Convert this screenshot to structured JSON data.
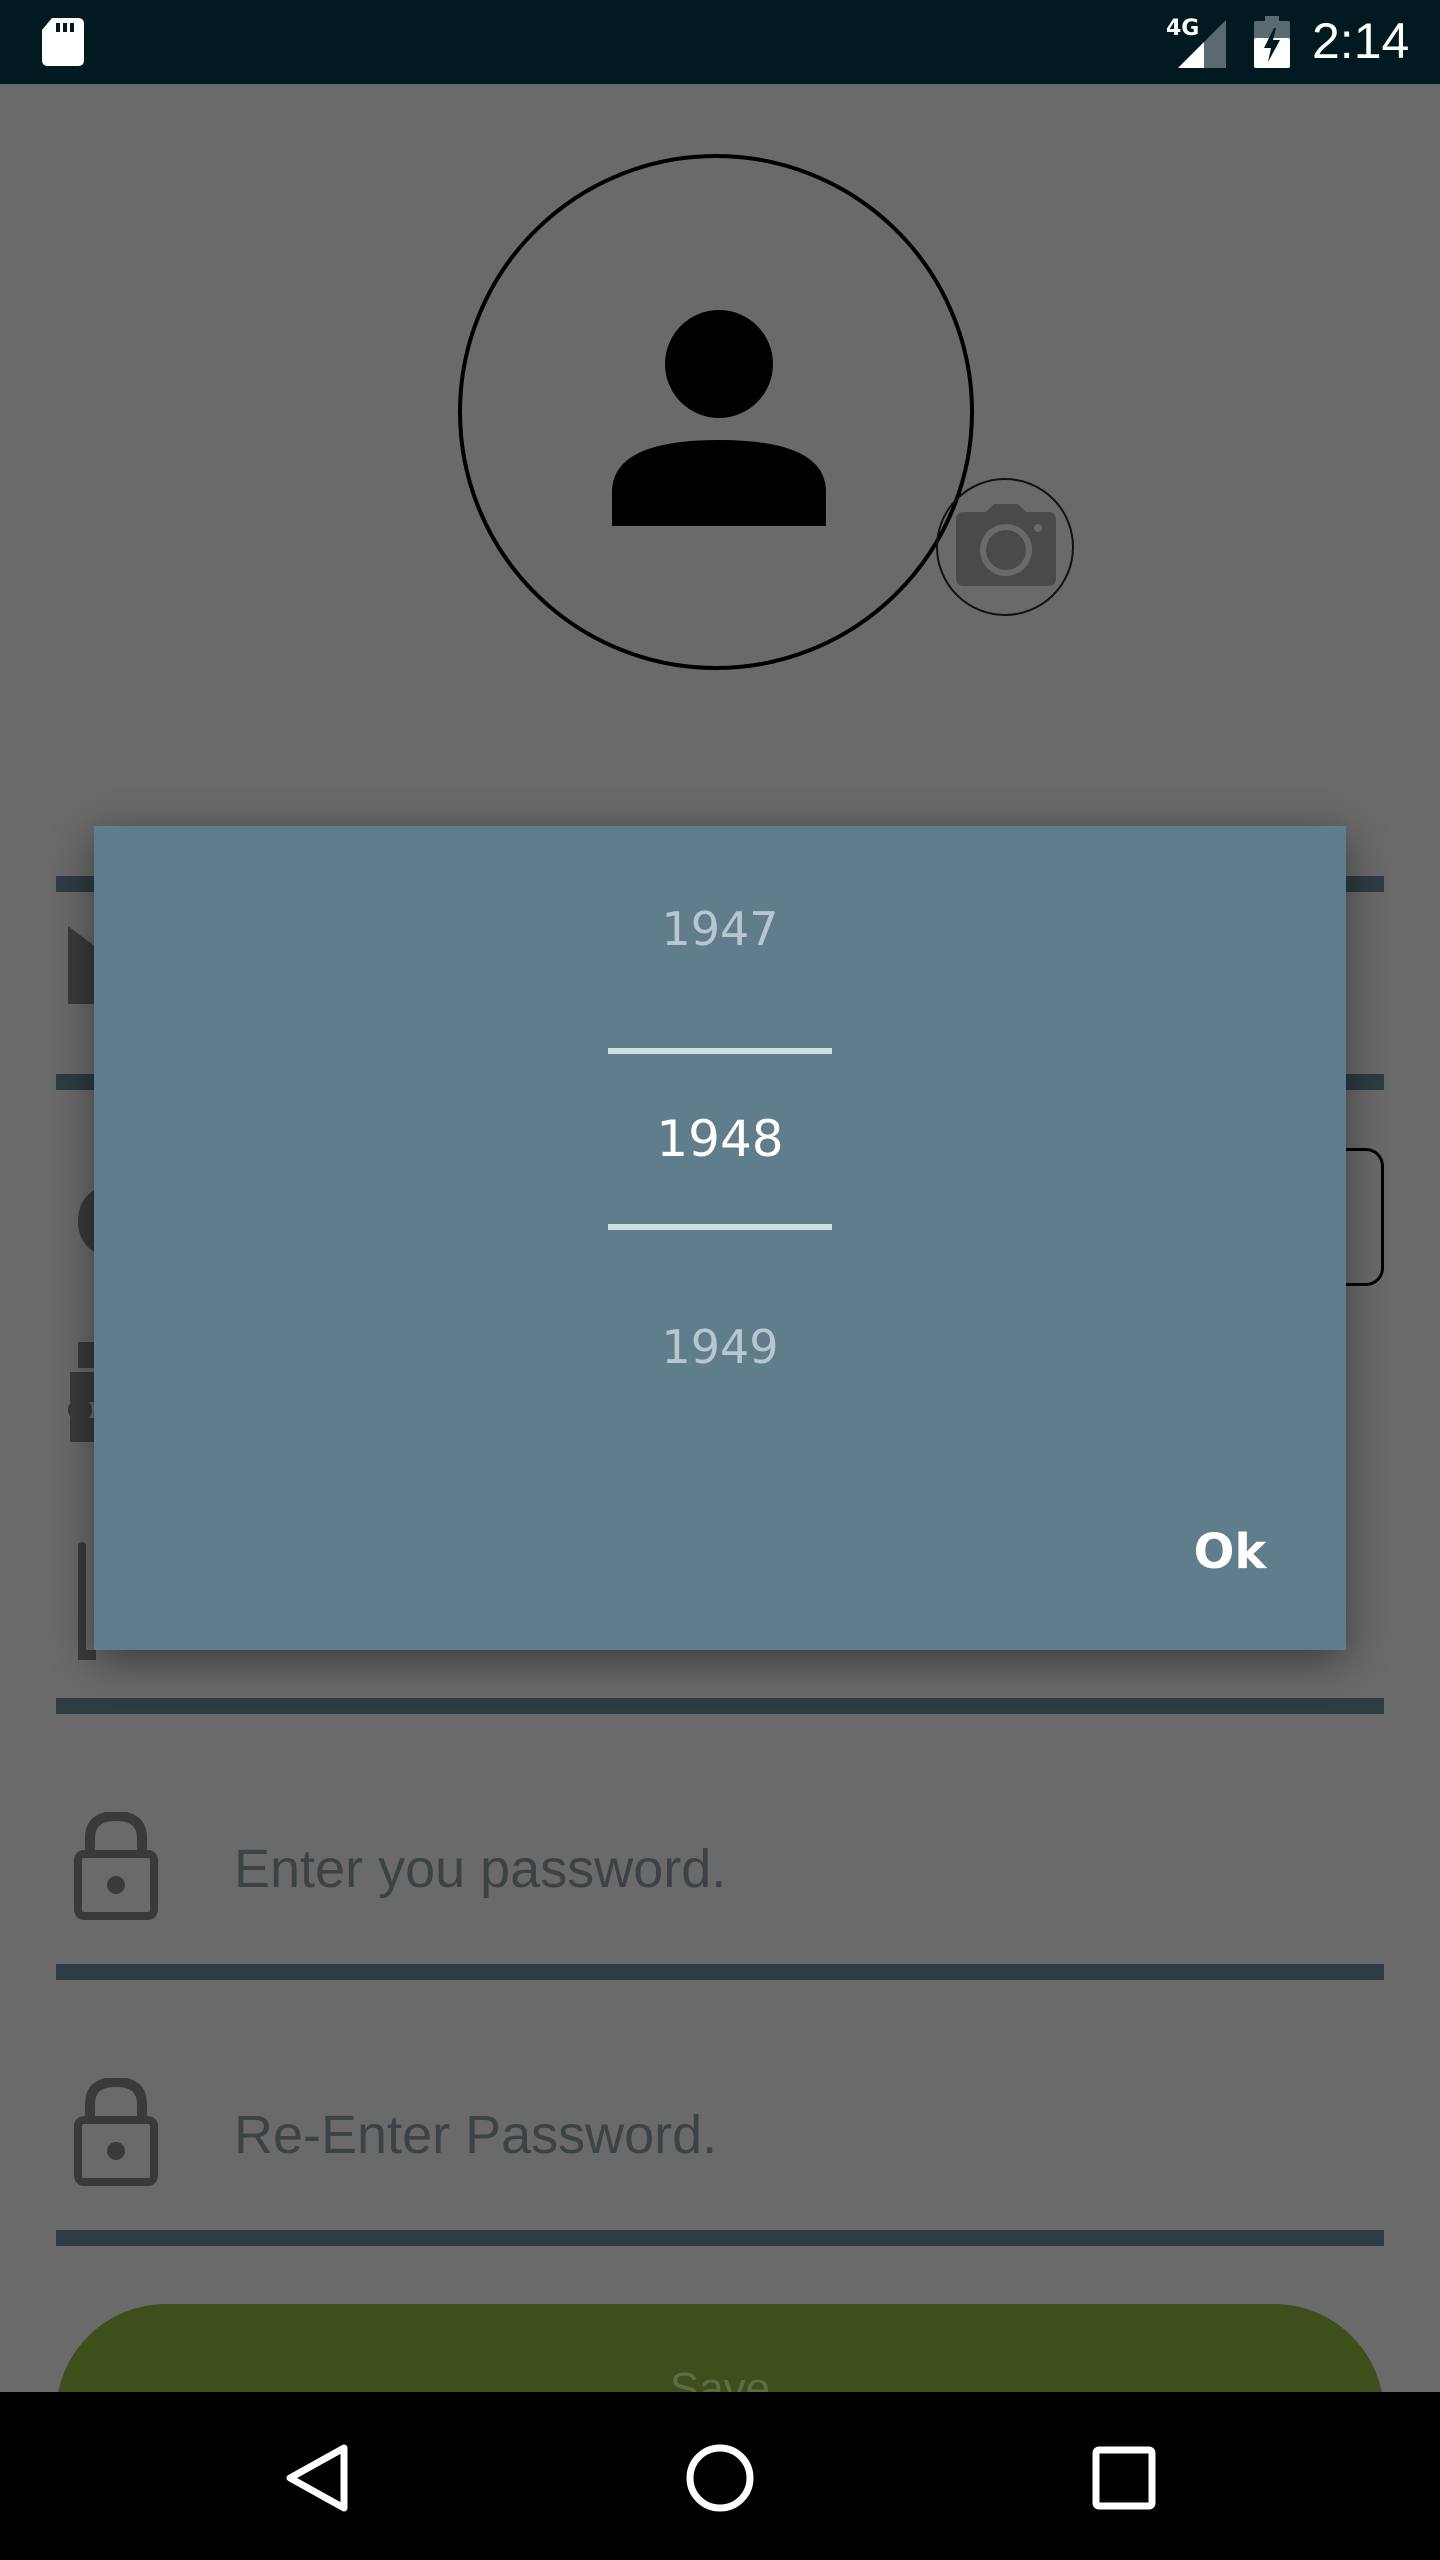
{
  "status_bar": {
    "network": "4G",
    "time": "2:14",
    "icons": [
      "sd-card-icon",
      "signal-icon",
      "battery-charging-icon"
    ]
  },
  "profile": {
    "avatar_icon": "person-icon",
    "camera_icon": "camera-icon"
  },
  "form": {
    "password_placeholder": "Enter you password.",
    "reenter_password_placeholder": "Re-Enter Password.",
    "save_label": "Save"
  },
  "year_picker": {
    "prev": "1947",
    "selected": "1948",
    "next": "1949",
    "ok_label": "Ok"
  },
  "colors": {
    "dialog_bg": "#607d8b",
    "field_line": "#2e3c44",
    "save_button": "#3e4f1c",
    "status_bar": "#001a20"
  },
  "nav_bar": {
    "icons": [
      "back-icon",
      "home-icon",
      "recents-icon"
    ]
  }
}
